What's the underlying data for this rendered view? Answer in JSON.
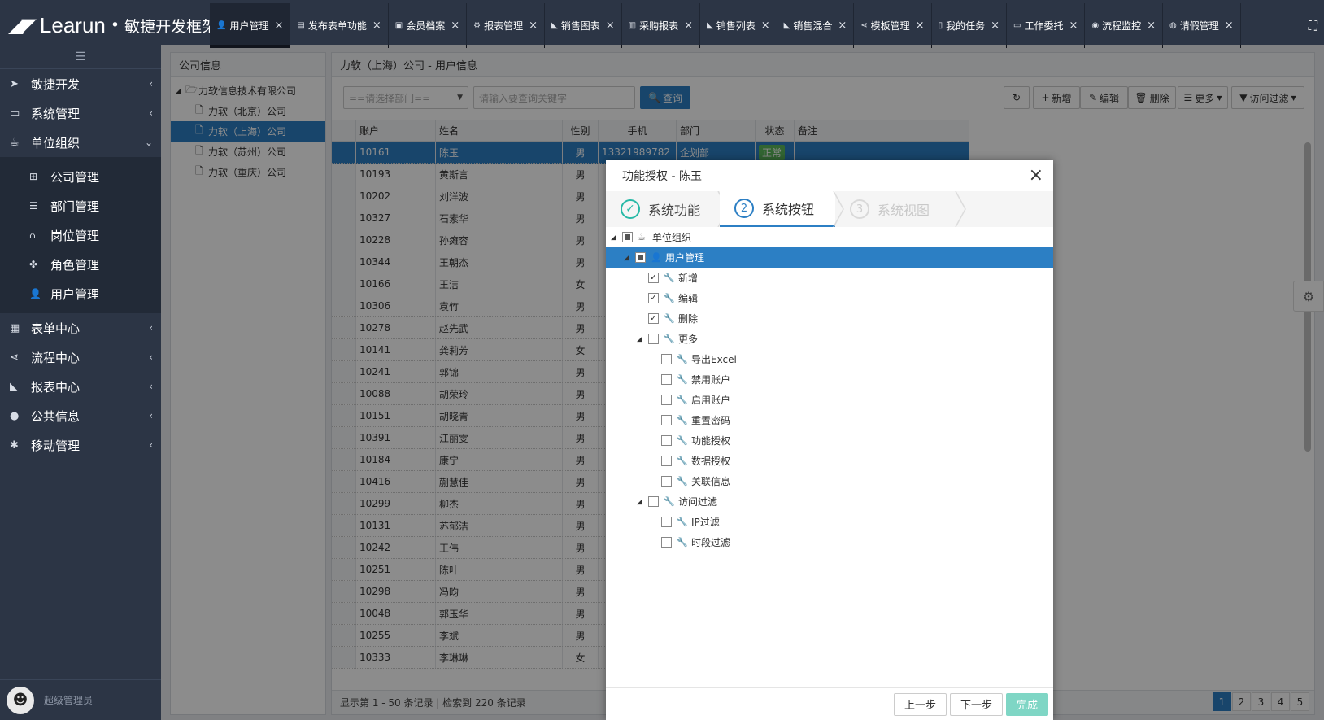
{
  "app": {
    "logo_mark": "◢◤",
    "brand": "Learun",
    "dot": "•",
    "subtitle": "敏捷开发框架"
  },
  "tabs": [
    {
      "icon": "user-icon",
      "glyph": "👤",
      "label": "用户管理"
    },
    {
      "icon": "form-icon",
      "glyph": "▤",
      "label": "发布表单功能"
    },
    {
      "icon": "card-icon",
      "glyph": "▣",
      "label": "会员档案"
    },
    {
      "icon": "cogs-icon",
      "glyph": "⚙",
      "label": "报表管理"
    },
    {
      "icon": "area-chart-icon",
      "glyph": "◣",
      "label": "销售图表"
    },
    {
      "icon": "bar-chart-icon",
      "glyph": "▥",
      "label": "采购报表"
    },
    {
      "icon": "area-chart-icon",
      "glyph": "◣",
      "label": "销售列表"
    },
    {
      "icon": "area-chart-icon",
      "glyph": "◣",
      "label": "销售混合"
    },
    {
      "icon": "share-icon",
      "glyph": "⋖",
      "label": "模板管理"
    },
    {
      "icon": "file-icon",
      "glyph": "▯",
      "label": "我的任务"
    },
    {
      "icon": "desktop-icon",
      "glyph": "▭",
      "label": "工作委托"
    },
    {
      "icon": "eye-icon",
      "glyph": "◉",
      "label": "流程监控"
    },
    {
      "icon": "user-circle-icon",
      "glyph": "◍",
      "label": "请假管理"
    }
  ],
  "sidebar": {
    "menu": [
      {
        "icon": "send-icon",
        "glyph": "➤",
        "label": "敏捷开发"
      },
      {
        "icon": "desktop-icon",
        "glyph": "▭",
        "label": "系统管理"
      },
      {
        "icon": "coffee-icon",
        "glyph": "☕",
        "label": "单位组织"
      }
    ],
    "submenu": [
      {
        "icon": "sitemap-icon",
        "glyph": "⊞",
        "label": "公司管理"
      },
      {
        "icon": "list-icon",
        "glyph": "☰",
        "label": "部门管理"
      },
      {
        "icon": "graduation-cap-icon",
        "glyph": "⌂",
        "label": "岗位管理"
      },
      {
        "icon": "paw-icon",
        "glyph": "✤",
        "label": "角色管理"
      },
      {
        "icon": "user-icon",
        "glyph": "👤",
        "label": "用户管理"
      }
    ],
    "menu2": [
      {
        "icon": "table-icon",
        "glyph": "▦",
        "label": "表单中心"
      },
      {
        "icon": "share-icon",
        "glyph": "⋖",
        "label": "流程中心"
      },
      {
        "icon": "area-chart-icon",
        "glyph": "◣",
        "label": "报表中心"
      },
      {
        "icon": "globe-icon",
        "glyph": "●",
        "label": "公共信息"
      },
      {
        "icon": "android-icon",
        "glyph": "✱",
        "label": "移动管理"
      }
    ],
    "user": "超级管理员"
  },
  "company_panel": {
    "title": "公司信息",
    "root": "力软信息技术有限公司",
    "children": [
      "力软（北京）公司",
      "力软（上海）公司",
      "力软（苏州）公司",
      "力软（重庆）公司"
    ],
    "selected_index": 1
  },
  "user_panel": {
    "title": "力软（上海）公司 - 用户信息",
    "dept_placeholder": "==请选择部门==",
    "keyword_placeholder": "请输入要查询关键字",
    "query_label": "查询",
    "actions": {
      "add": "新增",
      "edit": "编辑",
      "delete": "删除",
      "more": "更多",
      "filter": "访问过滤"
    },
    "columns": [
      "账户",
      "姓名",
      "性别",
      "手机",
      "部门",
      "状态",
      "备注"
    ],
    "rows": [
      {
        "n": "1",
        "account": "10161",
        "name": "陈玉",
        "gender": "男",
        "phone": "13321989782",
        "dept": "企划部",
        "status": "正常"
      },
      {
        "n": "2",
        "account": "10193",
        "name": "黄斯言",
        "gender": "男"
      },
      {
        "n": "3",
        "account": "10202",
        "name": "刘洋波",
        "gender": "男"
      },
      {
        "n": "4",
        "account": "10327",
        "name": "石素华",
        "gender": "男"
      },
      {
        "n": "5",
        "account": "10228",
        "name": "孙瘫容",
        "gender": "男"
      },
      {
        "n": "6",
        "account": "10344",
        "name": "王朝杰",
        "gender": "男"
      },
      {
        "n": "7",
        "account": "10166",
        "name": "王洁",
        "gender": "女"
      },
      {
        "n": "8",
        "account": "10306",
        "name": "袁竹",
        "gender": "男"
      },
      {
        "n": "9",
        "account": "10278",
        "name": "赵先武",
        "gender": "男"
      },
      {
        "n": "10",
        "account": "10141",
        "name": "龚莉芳",
        "gender": "女"
      },
      {
        "n": "11",
        "account": "10241",
        "name": "郭锦",
        "gender": "男"
      },
      {
        "n": "12",
        "account": "10088",
        "name": "胡荣玲",
        "gender": "男"
      },
      {
        "n": "13",
        "account": "10151",
        "name": "胡晓青",
        "gender": "男"
      },
      {
        "n": "14",
        "account": "10391",
        "name": "江丽雯",
        "gender": "男"
      },
      {
        "n": "15",
        "account": "10184",
        "name": "康宁",
        "gender": "男"
      },
      {
        "n": "16",
        "account": "10416",
        "name": "蒯慧佳",
        "gender": "男"
      },
      {
        "n": "17",
        "account": "10299",
        "name": "柳杰",
        "gender": "男"
      },
      {
        "n": "18",
        "account": "10131",
        "name": "苏郁洁",
        "gender": "男"
      },
      {
        "n": "19",
        "account": "10242",
        "name": "王伟",
        "gender": "男"
      },
      {
        "n": "20",
        "account": "10251",
        "name": "陈叶",
        "gender": "男"
      },
      {
        "n": "21",
        "account": "10298",
        "name": "冯昀",
        "gender": "男"
      },
      {
        "n": "22",
        "account": "10048",
        "name": "郭玉华",
        "gender": "男"
      },
      {
        "n": "23",
        "account": "10255",
        "name": "李斌",
        "gender": "男"
      },
      {
        "n": "24",
        "account": "10333",
        "name": "李琳琳",
        "gender": "女"
      }
    ],
    "footer": "显示第 1 - 50 条记录 | 检索到 220 条记录",
    "pages": [
      "1",
      "2",
      "3",
      "4",
      "5"
    ],
    "current_page": "1"
  },
  "modal": {
    "title": "功能授权 - 陈玉",
    "close": "×",
    "steps": [
      {
        "num": "✓",
        "label": "系统功能",
        "state": "done"
      },
      {
        "num": "2",
        "label": "系统按钮",
        "state": "active"
      },
      {
        "num": "3",
        "label": "系统视图",
        "state": "todo"
      }
    ],
    "tree": [
      {
        "level": 0,
        "toggle": "◢",
        "check": "partial",
        "icon": "coffee-icon",
        "glyph": "☕",
        "label": "单位组织"
      },
      {
        "level": 1,
        "toggle": "◢",
        "check": "partial",
        "icon": "user-icon",
        "glyph": "👤",
        "label": "用户管理",
        "selected": true
      },
      {
        "level": 2,
        "toggle": "",
        "check": "checked",
        "icon": "wrench-icon",
        "glyph": "🔧",
        "label": "新增"
      },
      {
        "level": 2,
        "toggle": "",
        "check": "checked",
        "icon": "wrench-icon",
        "glyph": "🔧",
        "label": "编辑"
      },
      {
        "level": 2,
        "toggle": "",
        "check": "checked",
        "icon": "wrench-icon",
        "glyph": "🔧",
        "label": "删除"
      },
      {
        "level": 2,
        "toggle": "◢",
        "check": "unchecked",
        "icon": "wrench-icon",
        "glyph": "🔧",
        "label": "更多"
      },
      {
        "level": 3,
        "toggle": "",
        "check": "unchecked",
        "icon": "wrench-icon",
        "glyph": "🔧",
        "label": "导出Excel"
      },
      {
        "level": 3,
        "toggle": "",
        "check": "unchecked",
        "icon": "wrench-icon",
        "glyph": "🔧",
        "label": "禁用账户"
      },
      {
        "level": 3,
        "toggle": "",
        "check": "unchecked",
        "icon": "wrench-icon",
        "glyph": "🔧",
        "label": "启用账户"
      },
      {
        "level": 3,
        "toggle": "",
        "check": "unchecked",
        "icon": "wrench-icon",
        "glyph": "🔧",
        "label": "重置密码"
      },
      {
        "level": 3,
        "toggle": "",
        "check": "unchecked",
        "icon": "wrench-icon",
        "glyph": "🔧",
        "label": "功能授权"
      },
      {
        "level": 3,
        "toggle": "",
        "check": "unchecked",
        "icon": "wrench-icon",
        "glyph": "🔧",
        "label": "数据授权"
      },
      {
        "level": 3,
        "toggle": "",
        "check": "unchecked",
        "icon": "wrench-icon",
        "glyph": "🔧",
        "label": "关联信息"
      },
      {
        "level": 2,
        "toggle": "◢",
        "check": "unchecked",
        "icon": "wrench-icon",
        "glyph": "🔧",
        "label": "访问过滤"
      },
      {
        "level": 3,
        "toggle": "",
        "check": "unchecked",
        "icon": "wrench-icon",
        "glyph": "🔧",
        "label": "IP过滤"
      },
      {
        "level": 3,
        "toggle": "",
        "check": "unchecked",
        "icon": "wrench-icon",
        "glyph": "🔧",
        "label": "时段过滤"
      }
    ],
    "buttons": {
      "prev": "上一步",
      "next": "下一步",
      "finish": "完成"
    }
  },
  "colors": {
    "primary": "#2c7fc4",
    "sidebar": "#2c3545",
    "success": "#27b9a6",
    "status_ok": "#5cb85c"
  }
}
